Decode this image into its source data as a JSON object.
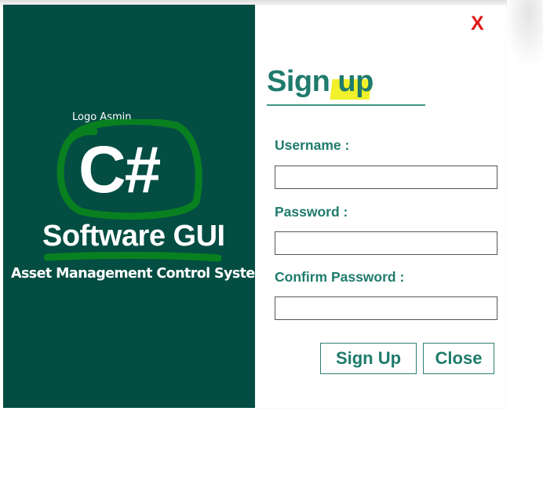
{
  "brand": {
    "logo_caption": "Logo Asmin",
    "logo_text": "C#",
    "product_name": "Software GUI",
    "tagline": "Asset Management Control System"
  },
  "form": {
    "title_part1": "Sign ",
    "title_part2": "up",
    "close_glyph": "X",
    "username_label": "Username :",
    "username_value": "",
    "password_label": "Password :",
    "password_value": "",
    "confirm_label": "Confirm Password :",
    "confirm_value": "",
    "signup_button": "Sign Up",
    "close_button": "Close"
  },
  "colors": {
    "panel_bg": "#034d43",
    "accent_text": "#1f7b6c",
    "close_x": "#e01818",
    "highlight": "#f1f02a",
    "scribble": "#0b8a1a"
  }
}
